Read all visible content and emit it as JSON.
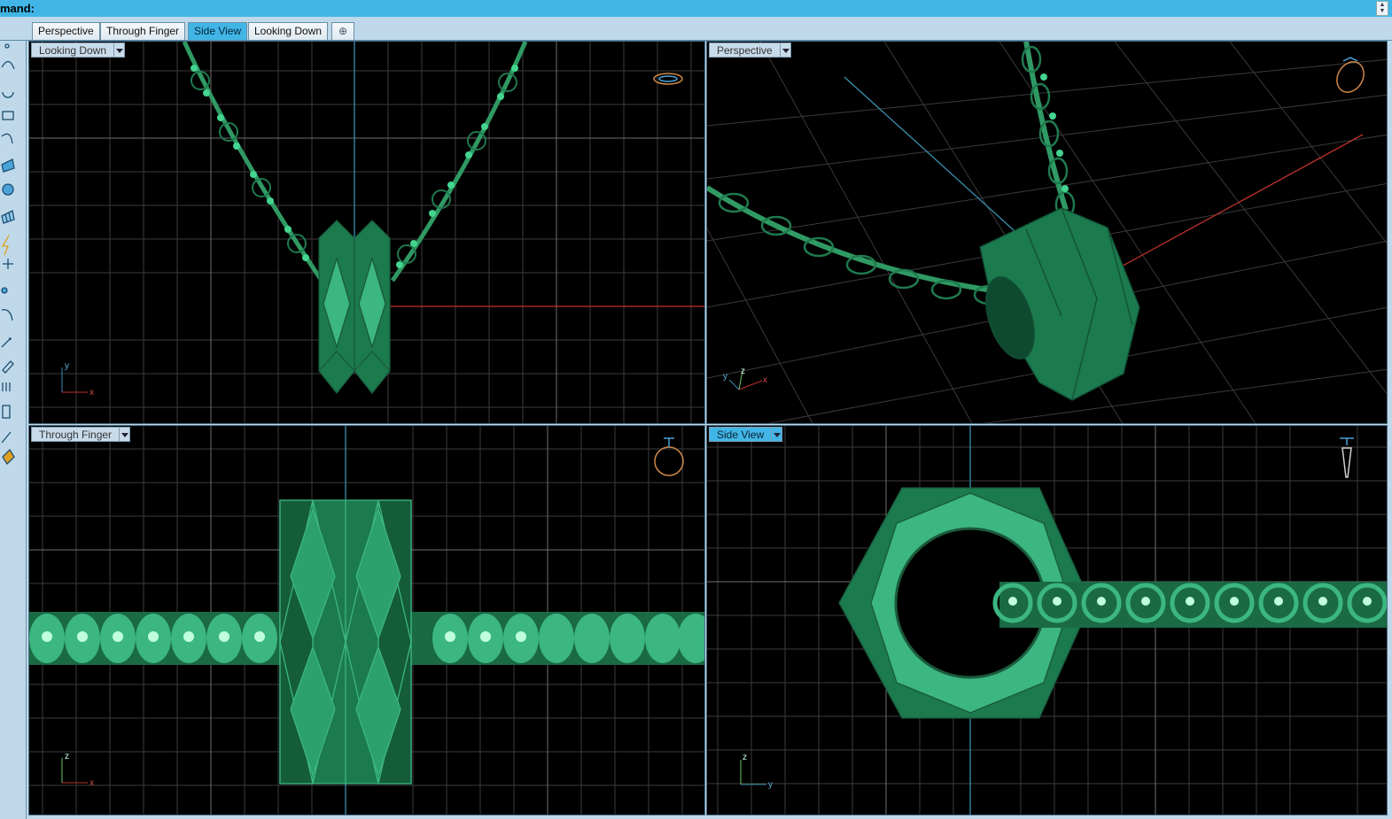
{
  "command": {
    "label": "mand:"
  },
  "tabs": [
    "Perspective",
    "Through Finger",
    "Side View",
    "Looking Down"
  ],
  "active_tab": "Side View",
  "add_tab_icon": "plus-icon",
  "toolbar": {
    "icons": [
      "point-icon",
      "curve-icon",
      "circle-icon",
      "rectangle-icon",
      "arc-icon",
      "surface-icon",
      "sphere-icon",
      "mesh-icon",
      "lightning-icon",
      "dimension-icon",
      "group-icon",
      "fillet-icon",
      "transform-icon",
      "ruler-icon",
      "array-icon",
      "boolean-icon",
      "pen-icon",
      "paint-bucket-icon"
    ]
  },
  "viewports": {
    "top_left": {
      "name": "Looking Down",
      "active": false,
      "axes": [
        "y",
        "x"
      ]
    },
    "top_right": {
      "name": "Perspective",
      "active": false,
      "axes": [
        "y",
        "z",
        "x"
      ]
    },
    "bottom_left": {
      "name": "Through Finger",
      "active": false,
      "axes": [
        "z",
        "x"
      ]
    },
    "bottom_right": {
      "name": "Side View",
      "active": true,
      "axes": [
        "z",
        "y"
      ]
    }
  },
  "colors": {
    "accent": "#41b6e6",
    "grid": "#555555",
    "axis_x": "#c0322b",
    "axis_y": "#3a8fb0",
    "model": "#1f8a5c",
    "model_light": "#3ec48a",
    "ring_widget": "#d08a4a"
  }
}
